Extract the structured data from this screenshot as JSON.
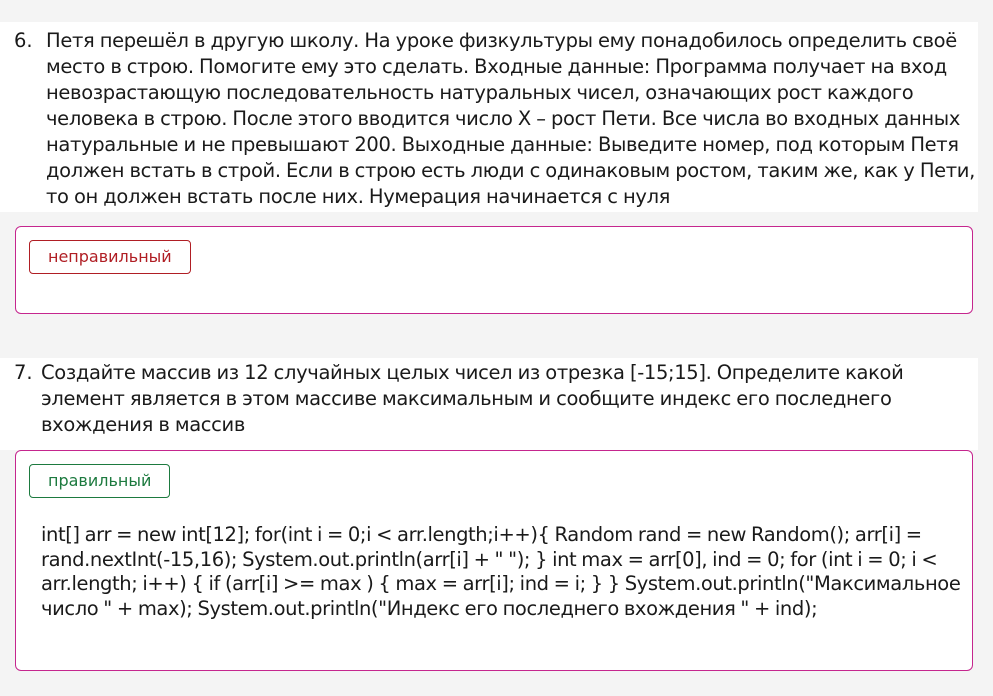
{
  "questions": [
    {
      "number": "6.",
      "text": "Петя перешёл в другую школу. На уроке физкультуры ему понадобилось определить своё место в строю. Помогите ему это сделать. Входные данные: Программа получает на вход невозрастающую последовательность натуральных чисел, означающих рост каждого человека в строю. После этого вводится число X – рост Пети. Все числа во входных данных натуральные и не превышают 200. Выходные данные: Выведите номер, под которым Петя должен встать в строй. Если в строю есть люди с одинаковым ростом, таким же, как у Пети, то он должен встать после них. Нумерация начинается с нуля",
      "status": "неправильный",
      "answer": ""
    },
    {
      "number": "7.",
      "text": "Создайте массив из 12 случайных целых чисел из отрезка [-15;15]. Определите какой элемент является в этом массиве максимальным и сообщите индекс его последнего вхождения в массив",
      "status": "правильный",
      "answer": "int[] arr = new int[12]; for(int i = 0;i < arr.length;i++){ Random rand = new Random(); arr[i] = rand.nextInt(-15,16); System.out.println(arr[i] + \" \"); } int max = arr[0], ind = 0; for (int i = 0; i < arr.length; i++) { if (arr[i] >= max ) { max = arr[i]; ind = i; } } System.out.println(\"Максимальное число \" + max); System.out.println(\"Индекс его последнего вхождения \" + ind);"
    }
  ],
  "colors": {
    "box_border": "#c5268e",
    "wrong": "#b01e24",
    "right": "#1d7a3f",
    "page_background": "#f4f4f4"
  }
}
